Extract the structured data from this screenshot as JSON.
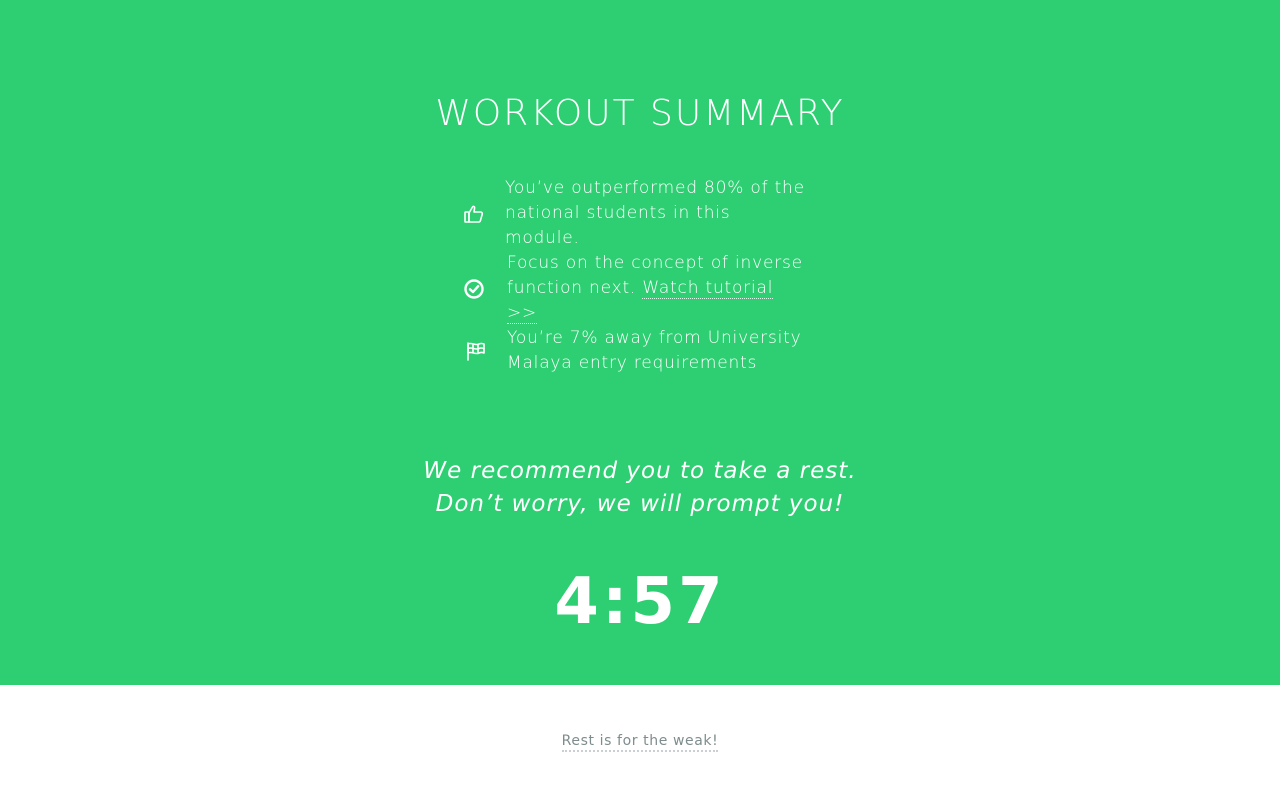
{
  "summary": {
    "title": "WORKOUT SUMMARY",
    "items": [
      {
        "icon": "thumbs-up-icon",
        "line1": "You’ve outperformed 80% of the",
        "line2": "national students in this module."
      },
      {
        "icon": "check-circle-icon",
        "line1": "Focus on the concept of inverse",
        "line2_prefix": "function next.",
        "link": "Watch tutorial >>"
      },
      {
        "icon": "flag-icon",
        "line1": "You’re 7% away from University",
        "line2": "Malaya entry requirements"
      }
    ]
  },
  "rest": {
    "line1": "We recommend you to take a rest.",
    "line2": "Don’t worry, we will prompt you!",
    "timer": "4:57"
  },
  "footer": {
    "link": "Rest is for the weak!"
  },
  "colors": {
    "accent": "#2ecf72",
    "footer_text": "#7f8c8d"
  }
}
